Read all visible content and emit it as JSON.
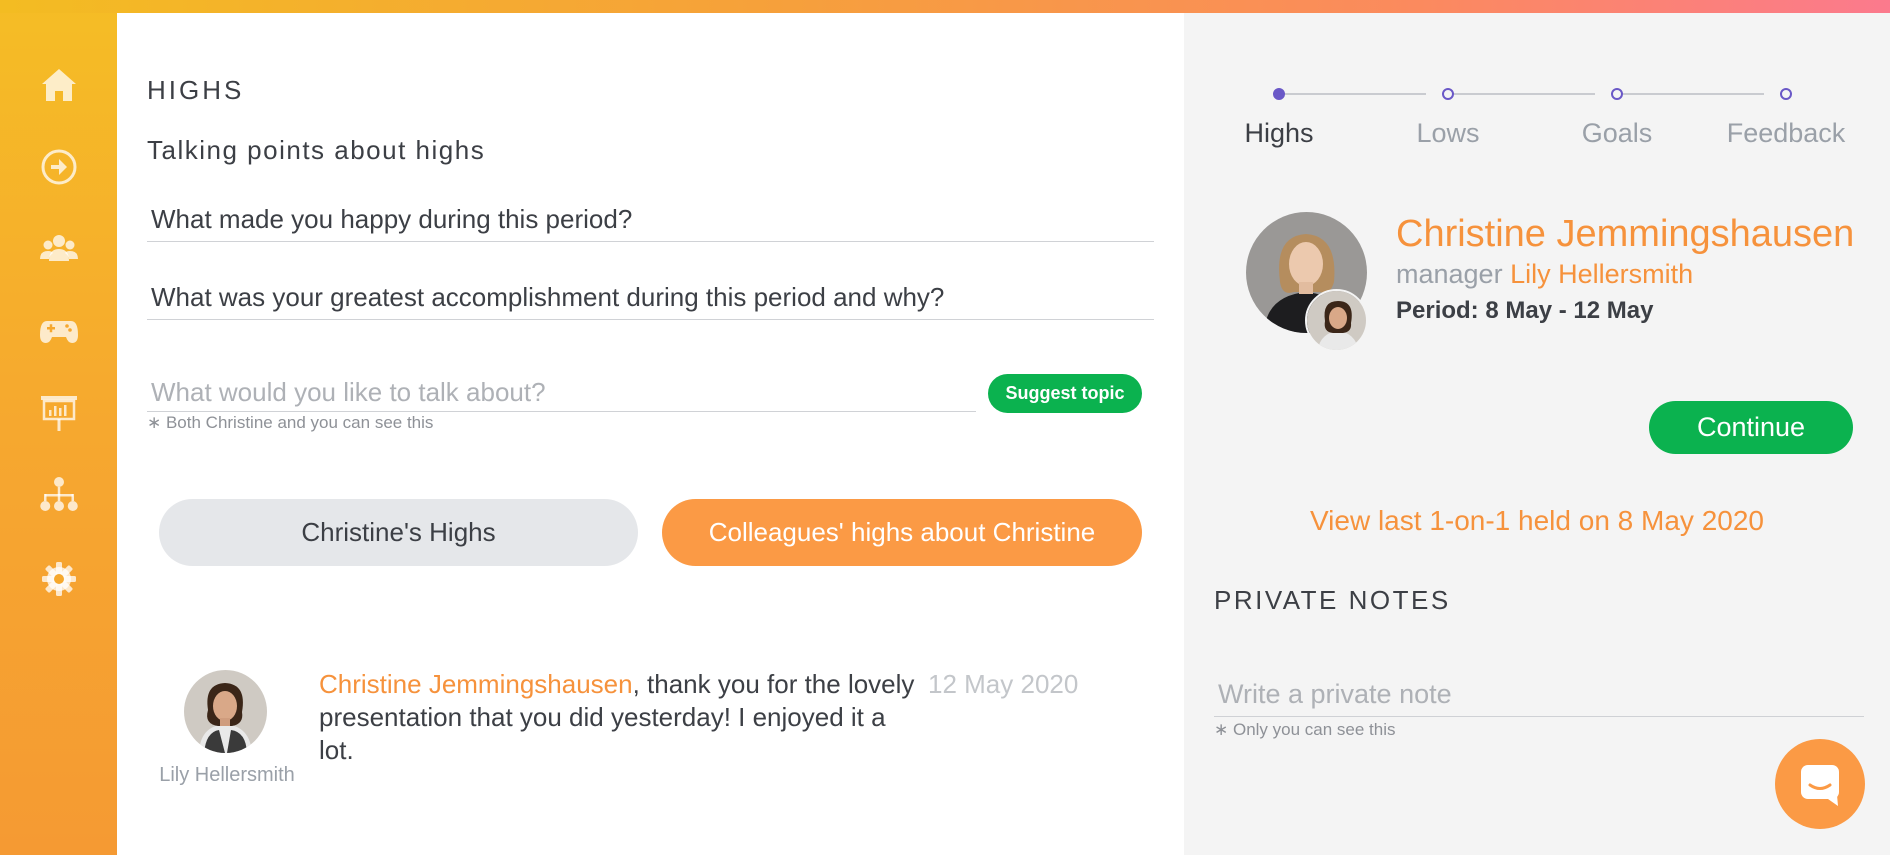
{
  "colors": {
    "accent": "#f6923c",
    "green": "#0bb24f",
    "purple": "#6a58c7",
    "sidebar": "#f6a82f"
  },
  "sidebar": {
    "items": [
      {
        "icon": "home-icon"
      },
      {
        "icon": "arrow-circle-right-icon"
      },
      {
        "icon": "people-icon"
      },
      {
        "icon": "gamepad-icon"
      },
      {
        "icon": "presentation-icon"
      },
      {
        "icon": "org-chart-icon"
      },
      {
        "icon": "gear-icon"
      }
    ]
  },
  "main": {
    "section_title": "HIGHS",
    "subtitle": "Talking points about highs",
    "topics": [
      "What made you happy during this period?",
      "What was your greatest accomplishment during this period and why?"
    ],
    "topic_input_placeholder": "What would you like to talk about?",
    "topic_hint": "∗ Both Christine and you can see this",
    "suggest_label": "Suggest topic",
    "tab_own": "Christine's Highs",
    "tab_colleagues": "Colleagues' highs about Christine",
    "comment": {
      "avatar_name": "Lily Hellersmith",
      "author": "Christine Jemmingshausen",
      "line1_rest": ", thank you for the lovely",
      "line2": "presentation that you did yesterday! I enjoyed it a",
      "line3": "lot.",
      "date": "12 May 2020"
    }
  },
  "right": {
    "steps": [
      {
        "label": "Highs",
        "active": true
      },
      {
        "label": "Lows",
        "active": false
      },
      {
        "label": "Goals",
        "active": false
      },
      {
        "label": "Feedback",
        "active": false
      }
    ],
    "employee_name": "Christine Jemmingshausen",
    "manager_prefix": "manager",
    "manager_name": "Lily Hellersmith",
    "period": "Period: 8 May - 12 May",
    "continue_label": "Continue",
    "view_last": "View last 1-on-1 held on 8 May 2020",
    "notes_title": "PRIVATE NOTES",
    "note_placeholder": "Write a private note",
    "note_hint": "∗ Only you can see this"
  },
  "chat": {
    "icon": "chat-icon"
  }
}
